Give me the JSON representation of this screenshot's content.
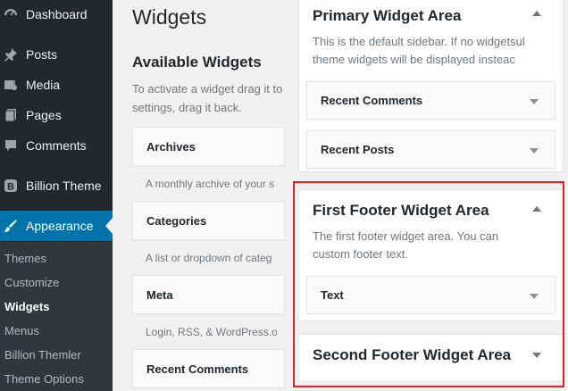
{
  "admin_menu": {
    "items": [
      {
        "label": "Dashboard",
        "icon": "dashboard-icon"
      },
      {
        "label": "Posts",
        "icon": "pin-icon"
      },
      {
        "label": "Media",
        "icon": "media-icon"
      },
      {
        "label": "Pages",
        "icon": "pages-icon"
      },
      {
        "label": "Comments",
        "icon": "comments-icon"
      },
      {
        "label": "Billion Theme",
        "icon": "b-logo-icon"
      },
      {
        "label": "Appearance",
        "icon": "brush-icon"
      }
    ],
    "submenu": [
      "Themes",
      "Customize",
      "Widgets",
      "Menus",
      "Billion Themler",
      "Theme Options"
    ],
    "current_submenu": "Widgets"
  },
  "page": {
    "title": "Widgets",
    "available_title": "Available Widgets",
    "available_desc_line1": "To activate a widget drag it to",
    "available_desc_line2": "settings, drag it back."
  },
  "available_widgets": [
    {
      "name": "Archives",
      "desc": "A monthly archive of your s"
    },
    {
      "name": "Categories",
      "desc": "A list or dropdown of categ"
    },
    {
      "name": "Meta",
      "desc": "Login, RSS, & WordPress.o"
    },
    {
      "name": "Recent Comments",
      "desc": ""
    }
  ],
  "widget_areas": {
    "primary": {
      "title": "Primary Widget Area",
      "desc_line1": "This is the default sidebar. If no widgetsult",
      "desc_line2": "theme widgets will be displayed insteac",
      "widgets": [
        "Recent Comments",
        "Recent Posts"
      ]
    },
    "first_footer": {
      "title": "First Footer Widget Area",
      "desc_line1": "The first footer widget area. You can",
      "desc_line2": "custom footer text.",
      "widgets": [
        "Text"
      ]
    },
    "second_footer": {
      "title": "Second Footer Widget Area"
    }
  },
  "colors": {
    "admin_bg": "#23282d",
    "active_blue": "#0073aa",
    "highlight_red": "#e32028"
  }
}
